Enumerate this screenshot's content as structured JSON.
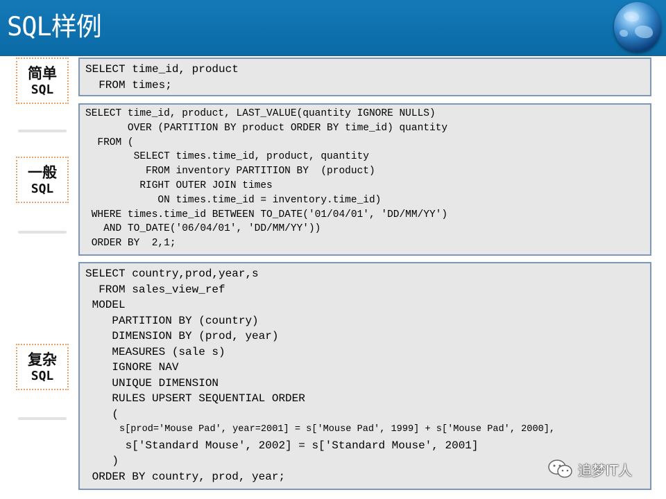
{
  "header": {
    "title": "SQL样例",
    "logo_icon": "globe-icon",
    "background_color": "#0a6aa6"
  },
  "sections": [
    {
      "id": "simple",
      "label_line1": "简单",
      "label_line2": "SQL",
      "code": "SELECT time_id, product\n  FROM times;"
    },
    {
      "id": "general",
      "label_line1": "一般",
      "label_line2": "SQL",
      "code": "SELECT time_id, product, LAST_VALUE(quantity IGNORE NULLS)\n       OVER (PARTITION BY product ORDER BY time_id) quantity\n  FROM (\n        SELECT times.time_id, product, quantity\n          FROM inventory PARTITION BY  (product)\n         RIGHT OUTER JOIN times\n            ON times.time_id = inventory.time_id)\n WHERE times.time_id BETWEEN TO_DATE('01/04/01', 'DD/MM/YY')\n   AND TO_DATE('06/04/01', 'DD/MM/YY'))\n ORDER BY  2,1;"
    },
    {
      "id": "complex",
      "label_line1": "复杂",
      "label_line2": "SQL",
      "code_top": "SELECT country,prod,year,s\n  FROM sales_view_ref\n MODEL\n    PARTITION BY (country)\n    DIMENSION BY (prod, year)\n    MEASURES (sale s)\n    IGNORE NAV\n    UNIQUE DIMENSION\n    RULES UPSERT SEQUENTIAL ORDER\n    (",
      "code_rule_small": "      s[prod='Mouse Pad', year=2001] = s['Mouse Pad', 1999] + s['Mouse Pad', 2000],",
      "code_bottom": "      s['Standard Mouse', 2002] = s['Standard Mouse', 2001]\n    )\n ORDER BY country, prod, year;"
    }
  ],
  "watermark": {
    "text": "追梦IT人",
    "icon": "wechat-icon"
  }
}
